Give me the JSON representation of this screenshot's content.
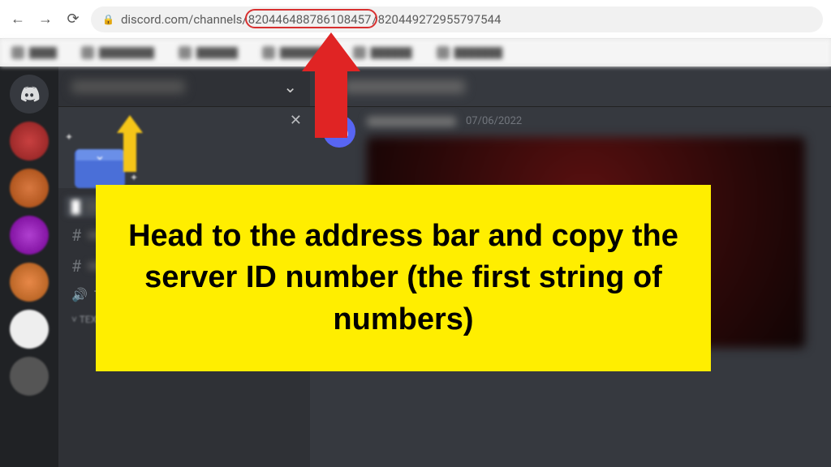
{
  "browser": {
    "url_prefix": "discord.com/channels/",
    "url_server_id": "820446488786108457",
    "url_channel_id": "820449272955797544",
    "url_separator": "/"
  },
  "discord": {
    "server_header_chevron": "⌄",
    "banner_close": "✕",
    "channels": {
      "voice_channel": "Taking a Nap",
      "text_category": "TEXT CHANNELS",
      "category_chevron": "˅",
      "category_plus": "+"
    },
    "message": {
      "date": "07/06/2022"
    },
    "hash": "#"
  },
  "annotation": {
    "callout_text": "Head to the address bar and copy the server ID number (the first string of numbers)"
  }
}
